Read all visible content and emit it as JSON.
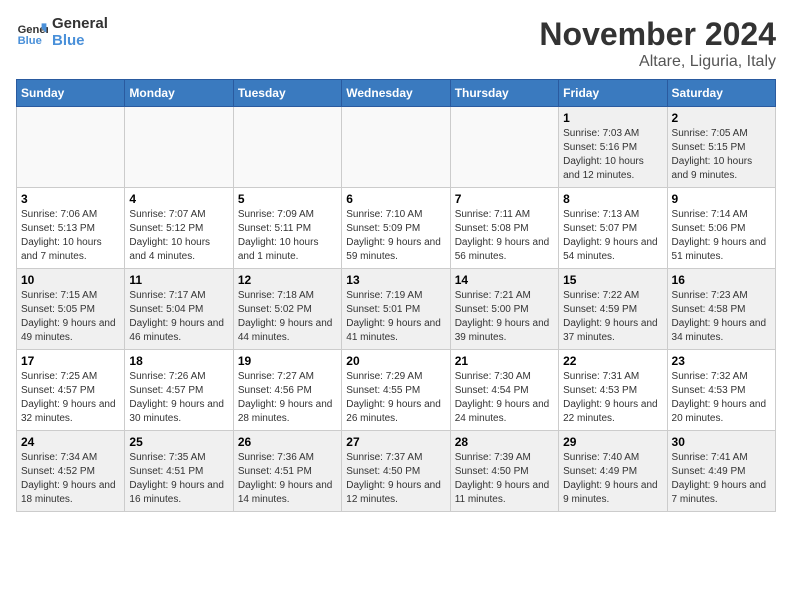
{
  "header": {
    "logo_general": "General",
    "logo_blue": "Blue",
    "month_title": "November 2024",
    "location": "Altare, Liguria, Italy"
  },
  "weekdays": [
    "Sunday",
    "Monday",
    "Tuesday",
    "Wednesday",
    "Thursday",
    "Friday",
    "Saturday"
  ],
  "weeks": [
    [
      {
        "day": "",
        "info": ""
      },
      {
        "day": "",
        "info": ""
      },
      {
        "day": "",
        "info": ""
      },
      {
        "day": "",
        "info": ""
      },
      {
        "day": "",
        "info": ""
      },
      {
        "day": "1",
        "info": "Sunrise: 7:03 AM\nSunset: 5:16 PM\nDaylight: 10 hours and 12 minutes."
      },
      {
        "day": "2",
        "info": "Sunrise: 7:05 AM\nSunset: 5:15 PM\nDaylight: 10 hours and 9 minutes."
      }
    ],
    [
      {
        "day": "3",
        "info": "Sunrise: 7:06 AM\nSunset: 5:13 PM\nDaylight: 10 hours and 7 minutes."
      },
      {
        "day": "4",
        "info": "Sunrise: 7:07 AM\nSunset: 5:12 PM\nDaylight: 10 hours and 4 minutes."
      },
      {
        "day": "5",
        "info": "Sunrise: 7:09 AM\nSunset: 5:11 PM\nDaylight: 10 hours and 1 minute."
      },
      {
        "day": "6",
        "info": "Sunrise: 7:10 AM\nSunset: 5:09 PM\nDaylight: 9 hours and 59 minutes."
      },
      {
        "day": "7",
        "info": "Sunrise: 7:11 AM\nSunset: 5:08 PM\nDaylight: 9 hours and 56 minutes."
      },
      {
        "day": "8",
        "info": "Sunrise: 7:13 AM\nSunset: 5:07 PM\nDaylight: 9 hours and 54 minutes."
      },
      {
        "day": "9",
        "info": "Sunrise: 7:14 AM\nSunset: 5:06 PM\nDaylight: 9 hours and 51 minutes."
      }
    ],
    [
      {
        "day": "10",
        "info": "Sunrise: 7:15 AM\nSunset: 5:05 PM\nDaylight: 9 hours and 49 minutes."
      },
      {
        "day": "11",
        "info": "Sunrise: 7:17 AM\nSunset: 5:04 PM\nDaylight: 9 hours and 46 minutes."
      },
      {
        "day": "12",
        "info": "Sunrise: 7:18 AM\nSunset: 5:02 PM\nDaylight: 9 hours and 44 minutes."
      },
      {
        "day": "13",
        "info": "Sunrise: 7:19 AM\nSunset: 5:01 PM\nDaylight: 9 hours and 41 minutes."
      },
      {
        "day": "14",
        "info": "Sunrise: 7:21 AM\nSunset: 5:00 PM\nDaylight: 9 hours and 39 minutes."
      },
      {
        "day": "15",
        "info": "Sunrise: 7:22 AM\nSunset: 4:59 PM\nDaylight: 9 hours and 37 minutes."
      },
      {
        "day": "16",
        "info": "Sunrise: 7:23 AM\nSunset: 4:58 PM\nDaylight: 9 hours and 34 minutes."
      }
    ],
    [
      {
        "day": "17",
        "info": "Sunrise: 7:25 AM\nSunset: 4:57 PM\nDaylight: 9 hours and 32 minutes."
      },
      {
        "day": "18",
        "info": "Sunrise: 7:26 AM\nSunset: 4:57 PM\nDaylight: 9 hours and 30 minutes."
      },
      {
        "day": "19",
        "info": "Sunrise: 7:27 AM\nSunset: 4:56 PM\nDaylight: 9 hours and 28 minutes."
      },
      {
        "day": "20",
        "info": "Sunrise: 7:29 AM\nSunset: 4:55 PM\nDaylight: 9 hours and 26 minutes."
      },
      {
        "day": "21",
        "info": "Sunrise: 7:30 AM\nSunset: 4:54 PM\nDaylight: 9 hours and 24 minutes."
      },
      {
        "day": "22",
        "info": "Sunrise: 7:31 AM\nSunset: 4:53 PM\nDaylight: 9 hours and 22 minutes."
      },
      {
        "day": "23",
        "info": "Sunrise: 7:32 AM\nSunset: 4:53 PM\nDaylight: 9 hours and 20 minutes."
      }
    ],
    [
      {
        "day": "24",
        "info": "Sunrise: 7:34 AM\nSunset: 4:52 PM\nDaylight: 9 hours and 18 minutes."
      },
      {
        "day": "25",
        "info": "Sunrise: 7:35 AM\nSunset: 4:51 PM\nDaylight: 9 hours and 16 minutes."
      },
      {
        "day": "26",
        "info": "Sunrise: 7:36 AM\nSunset: 4:51 PM\nDaylight: 9 hours and 14 minutes."
      },
      {
        "day": "27",
        "info": "Sunrise: 7:37 AM\nSunset: 4:50 PM\nDaylight: 9 hours and 12 minutes."
      },
      {
        "day": "28",
        "info": "Sunrise: 7:39 AM\nSunset: 4:50 PM\nDaylight: 9 hours and 11 minutes."
      },
      {
        "day": "29",
        "info": "Sunrise: 7:40 AM\nSunset: 4:49 PM\nDaylight: 9 hours and 9 minutes."
      },
      {
        "day": "30",
        "info": "Sunrise: 7:41 AM\nSunset: 4:49 PM\nDaylight: 9 hours and 7 minutes."
      }
    ]
  ]
}
